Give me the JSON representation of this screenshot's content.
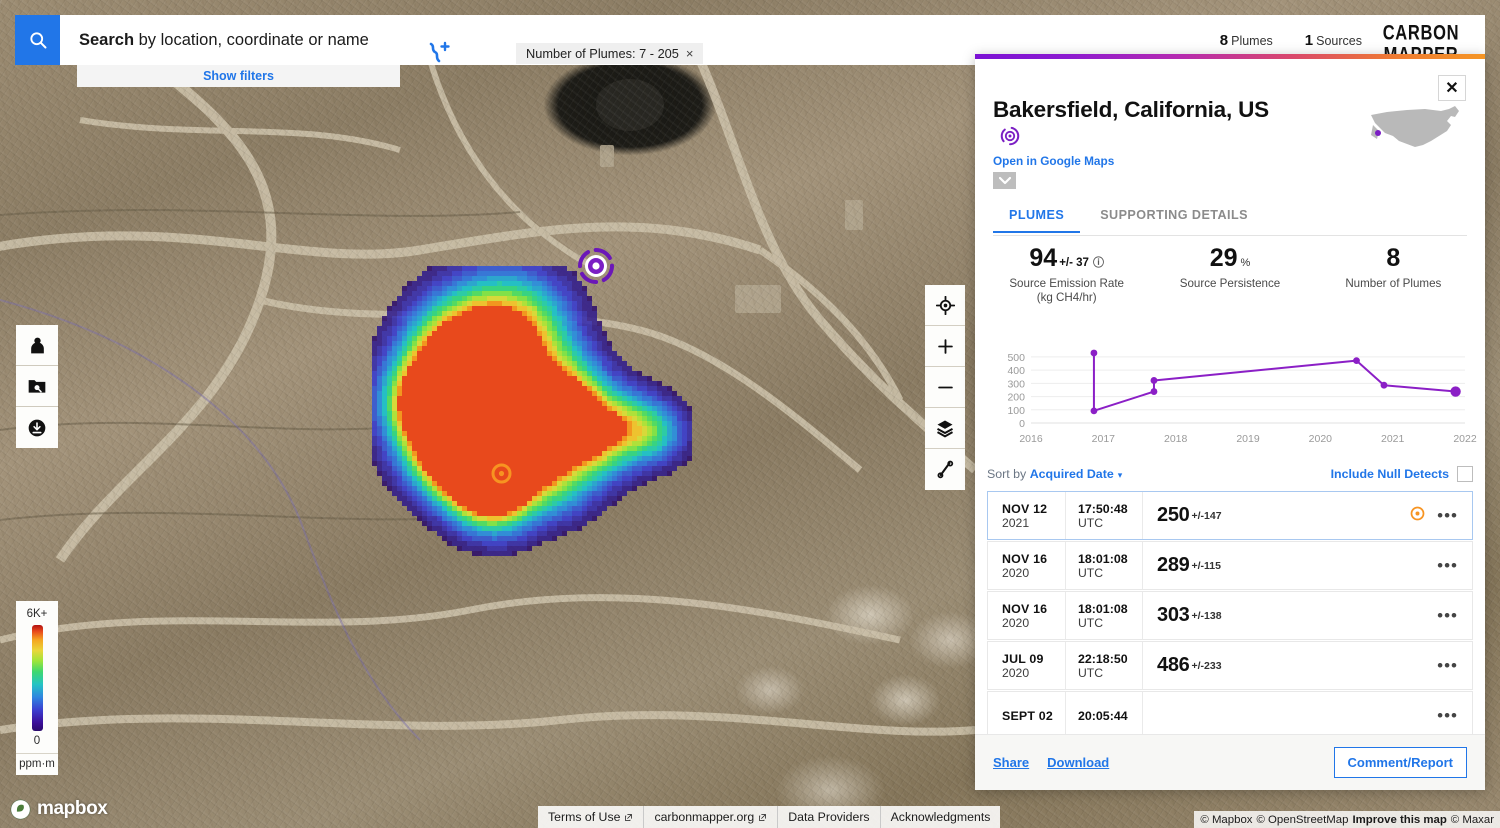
{
  "topbar": {
    "search_label_bold": "Search",
    "search_label_rest": " by location, coordinate or name",
    "search_placeholder": "Search by location, coordinate or name",
    "show_filters": "Show filters",
    "filter_chip": "Number of Plumes: 7 - 205",
    "chip_close": "×",
    "plumes_count": "8",
    "plumes_label": "Plumes",
    "sources_count": "1",
    "sources_label": "Sources",
    "logo_line1": "CARBON",
    "logo_line2": "MAPPER"
  },
  "colorbar": {
    "max": "6K+",
    "min": "0",
    "unit": "ppm·m"
  },
  "panel": {
    "close": "✕",
    "title": "Bakersfield, California, US",
    "google_maps_link": "Open in Google Maps",
    "expand_caret": "⌄",
    "tabs": [
      {
        "label": "PLUMES",
        "active": true
      },
      {
        "label": "SUPPORTING DETAILS",
        "active": false
      }
    ],
    "stats": [
      {
        "value": "94",
        "uncertainty": "+/- 37",
        "suffix": "",
        "info": "ⓘ",
        "label": "Source Emission Rate (kg CH4/hr)"
      },
      {
        "value": "29",
        "uncertainty": "",
        "suffix": "%",
        "info": "",
        "label": "Source Persistence"
      },
      {
        "value": "8",
        "uncertainty": "",
        "suffix": "",
        "info": "",
        "label": "Number of Plumes"
      }
    ],
    "sort_prefix": "Sort by",
    "sort_value": "Acquired Date",
    "sort_caret": "▾",
    "include_null_detects": "Include Null Detects",
    "rows": [
      {
        "date": "NOV 12",
        "year": "2021",
        "time": "17:50:48",
        "tz": "UTC",
        "value": "250",
        "error": "+/-147",
        "selected": true,
        "has_marker": true
      },
      {
        "date": "NOV 16",
        "year": "2020",
        "time": "18:01:08",
        "tz": "UTC",
        "value": "289",
        "error": "+/-115",
        "selected": false,
        "has_marker": false
      },
      {
        "date": "NOV 16",
        "year": "2020",
        "time": "18:01:08",
        "tz": "UTC",
        "value": "303",
        "error": "+/-138",
        "selected": false,
        "has_marker": false
      },
      {
        "date": "JUL 09",
        "year": "2020",
        "time": "22:18:50",
        "tz": "UTC",
        "value": "486",
        "error": "+/-233",
        "selected": false,
        "has_marker": false
      },
      {
        "date": "SEPT 02",
        "year": "",
        "time": "20:05:44",
        "tz": "",
        "value": "",
        "error": "",
        "selected": false,
        "has_marker": false
      }
    ],
    "dots": "•••",
    "footer": {
      "share": "Share",
      "download": "Download",
      "comment_report": "Comment/Report"
    }
  },
  "map_footer": {
    "mapbox": "mapbox",
    "links": [
      {
        "label": "Terms of Use",
        "external": true
      },
      {
        "label": "carbonmapper.org",
        "external": true
      },
      {
        "label": "Data Providers",
        "external": false
      },
      {
        "label": "Acknowledgments",
        "external": false
      }
    ],
    "attribution_a": "© Mapbox",
    "attribution_b": "© OpenStreetMap",
    "attribution_improve": "Improve this map",
    "attribution_c": "© Maxar"
  },
  "colors": {
    "accent_blue": "#2176e8",
    "brand_purple": "#7b12d4",
    "brand_orange": "#f59524",
    "plot_purple": "#8b1fc6",
    "marker_orange": "#f79421"
  },
  "chart_data": {
    "type": "line",
    "title": "",
    "xlabel": "",
    "ylabel": "",
    "xlim": [
      2016,
      2022
    ],
    "ylim": [
      0,
      560
    ],
    "yticks": [
      0,
      100,
      200,
      300,
      400,
      500
    ],
    "xticks": [
      "2016",
      "2017",
      "2018",
      "2019",
      "2020",
      "2021",
      "2022"
    ],
    "grid": true,
    "legend": false,
    "series": [
      {
        "name": "Source Emission Rate (kg CH4/hr)",
        "points": [
          {
            "x": 2016.87,
            "y": 530,
            "highlight": false
          },
          {
            "x": 2016.87,
            "y": 92,
            "highlight": false
          },
          {
            "x": 2017.7,
            "y": 238,
            "highlight": false
          },
          {
            "x": 2017.7,
            "y": 322,
            "highlight": false
          },
          {
            "x": 2020.5,
            "y": 472,
            "highlight": false
          },
          {
            "x": 2020.88,
            "y": 286,
            "highlight": false
          },
          {
            "x": 2021.87,
            "y": 238,
            "highlight": true
          }
        ]
      }
    ]
  }
}
